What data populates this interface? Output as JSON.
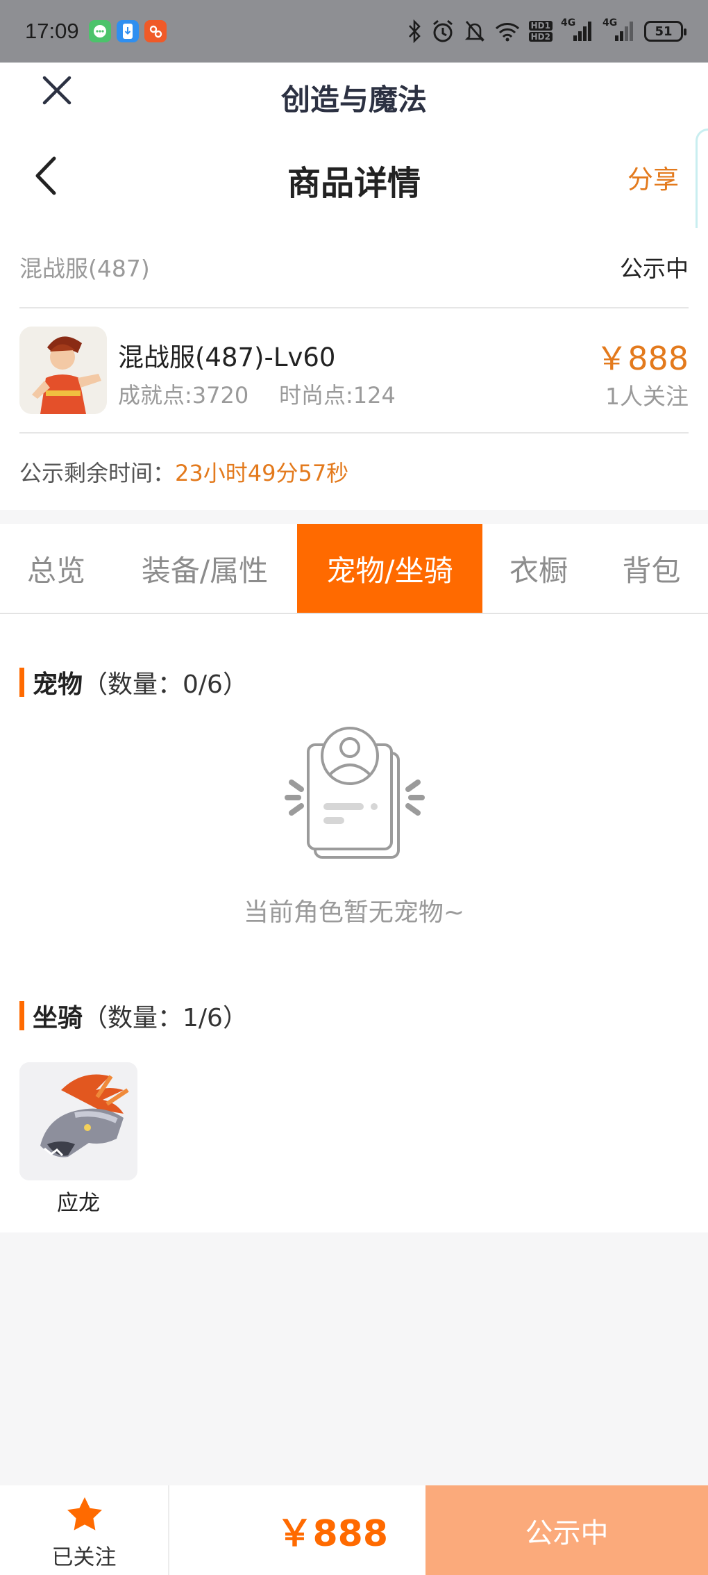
{
  "status_bar": {
    "time": "17:09",
    "battery": "51",
    "network_1": "4G",
    "network_2": "4G",
    "hd_1": "HD1",
    "hd_2": "HD2"
  },
  "app_bar": {
    "title": "创造与魔法"
  },
  "nav": {
    "title": "商品详情",
    "share_label": "分享"
  },
  "listing": {
    "server": "混战服(487)",
    "status": "公示中",
    "item_title": "混战服(487)-Lv60",
    "achievement": "成就点:3720",
    "fashion": "时尚点:124",
    "price": "￥888",
    "followers": "1人关注",
    "time_label": "公示剩余时间：",
    "time_value": "23小时49分57秒"
  },
  "tabs": [
    {
      "label": "总览"
    },
    {
      "label": "装备/属性"
    },
    {
      "label": "宠物/坐骑",
      "active": true
    },
    {
      "label": "衣橱"
    },
    {
      "label": "背包"
    }
  ],
  "pets": {
    "title": "宠物",
    "count": "（数量：0/6）",
    "empty_text": "当前角色暂无宠物~"
  },
  "mounts": {
    "title": "坐骑",
    "count": "（数量：1/6）",
    "items": [
      {
        "name": "应龙"
      }
    ]
  },
  "bottom_bar": {
    "follow_label": "已关注",
    "price": "￥888",
    "buy_label": "公示中"
  },
  "colors": {
    "accent": "#ff6a00",
    "price": "#e37a1d",
    "buy_disabled": "#fbaa7b"
  }
}
